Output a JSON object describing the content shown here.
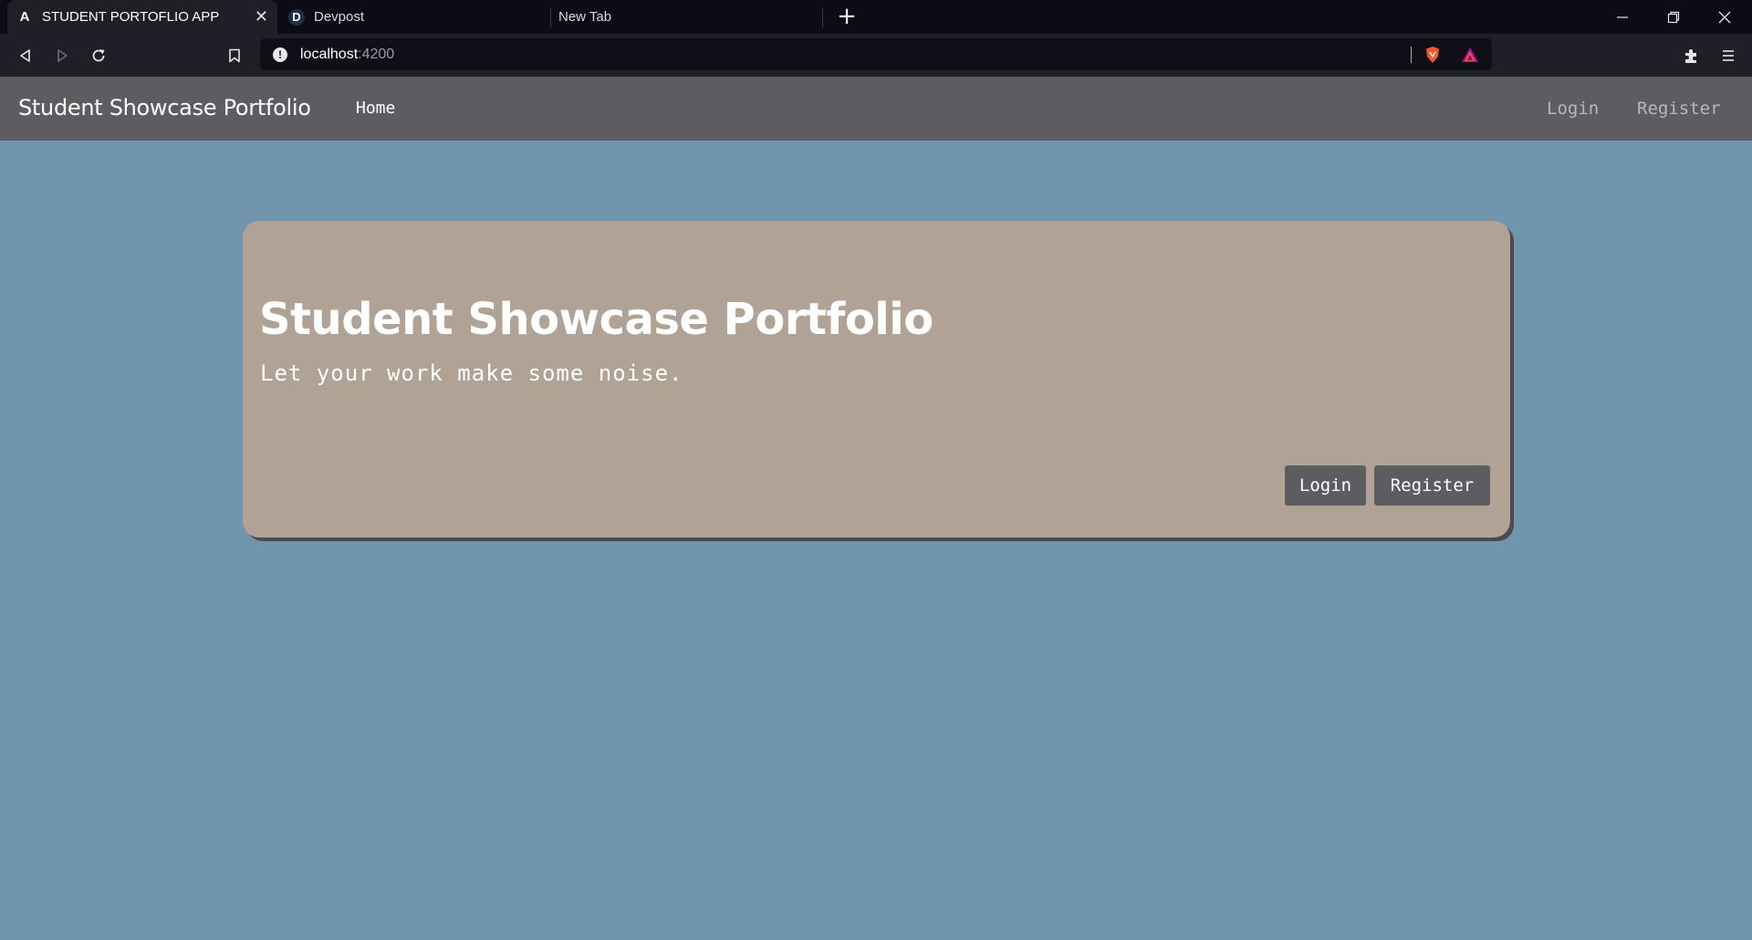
{
  "browser": {
    "tabs": [
      {
        "title": "STUDENT PORTOFLIO APP",
        "favicon": "angular-icon",
        "active": true
      },
      {
        "title": "Devpost",
        "favicon": "devpost-icon",
        "active": false
      },
      {
        "title": "New Tab",
        "active": false
      }
    ],
    "url": {
      "host": "localhost",
      "port": ":4200"
    }
  },
  "navbar": {
    "brand": "Student Showcase Portfolio",
    "home": "Home",
    "login": "Login",
    "register": "Register"
  },
  "hero": {
    "title": "Student Showcase Portfolio",
    "subtitle": "Let your work make some noise.",
    "login_button": "Login",
    "register_button": "Register"
  },
  "colors": {
    "page_background": "#7295ae",
    "navbar": "#5d5c61",
    "card": "#b0a294",
    "button": "#5d5c61"
  }
}
